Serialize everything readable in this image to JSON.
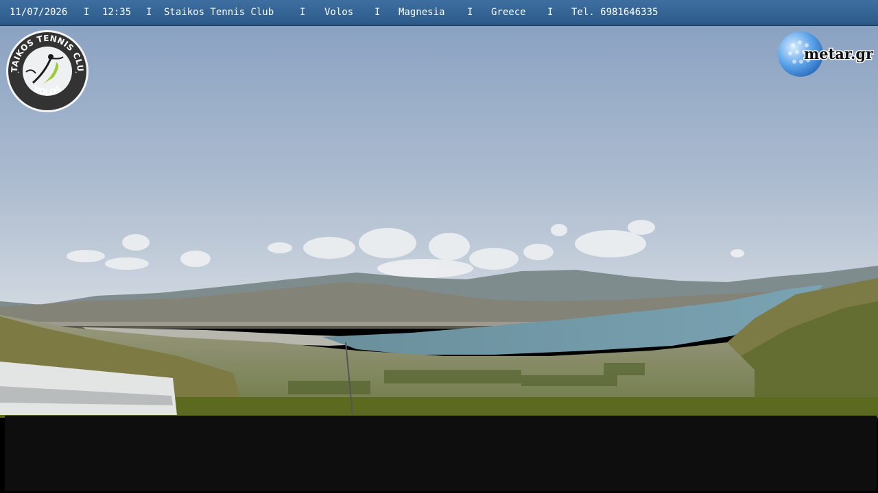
{
  "header": {
    "date": "11/07/2026",
    "time": "12:35",
    "club": "Staikos Tennis Club",
    "city": "Volos",
    "region": "Magnesia",
    "country": "Greece",
    "phone": "Tel. 6981646335",
    "separator": "I"
  },
  "logo_left": {
    "top_text": "STAIKOS TENNIS CLUB",
    "bottom_text": "VOLOS"
  },
  "logo_right": {
    "text": "metar.gr"
  },
  "colors": {
    "bar": "#2f5f90",
    "sky_top": "#8ba3c3",
    "sea": "#6f98a8"
  }
}
